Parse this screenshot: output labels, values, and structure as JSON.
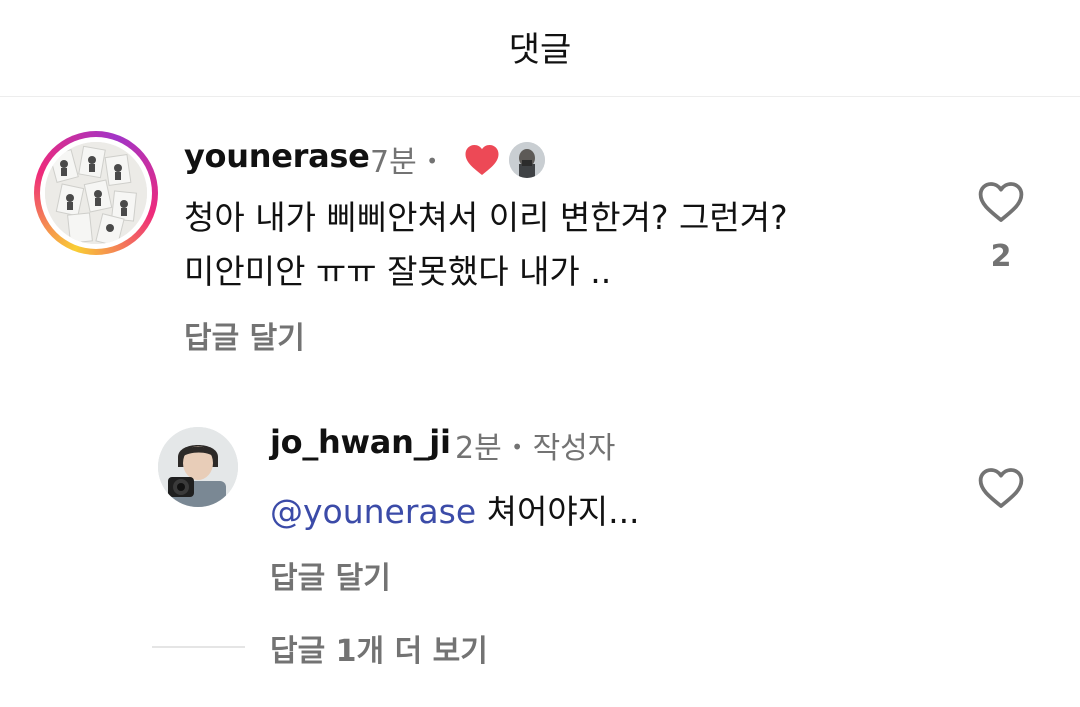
{
  "header": {
    "title": "댓글"
  },
  "comment": {
    "username": "younerase",
    "time": "7분",
    "separator": "•",
    "text_line1": "청아 내가 삐삐안쳐서 이리 변한겨? 그런겨?",
    "text_line2": "미안미안 ㅠㅠ 잘못했다 내가 ..",
    "reply_label": "답글 달기",
    "like_count": "2",
    "reaction_icon": "red-heart-icon",
    "heart_color": "#ed4956"
  },
  "reply": {
    "username": "jo_hwan_ji",
    "time": "2분",
    "separator": "•",
    "author_badge": "작성자",
    "mention": "@younerase",
    "text": "쳐어야지...",
    "reply_label": "답글 달기"
  },
  "view_more": {
    "label": "답글 1개 더 보기"
  }
}
